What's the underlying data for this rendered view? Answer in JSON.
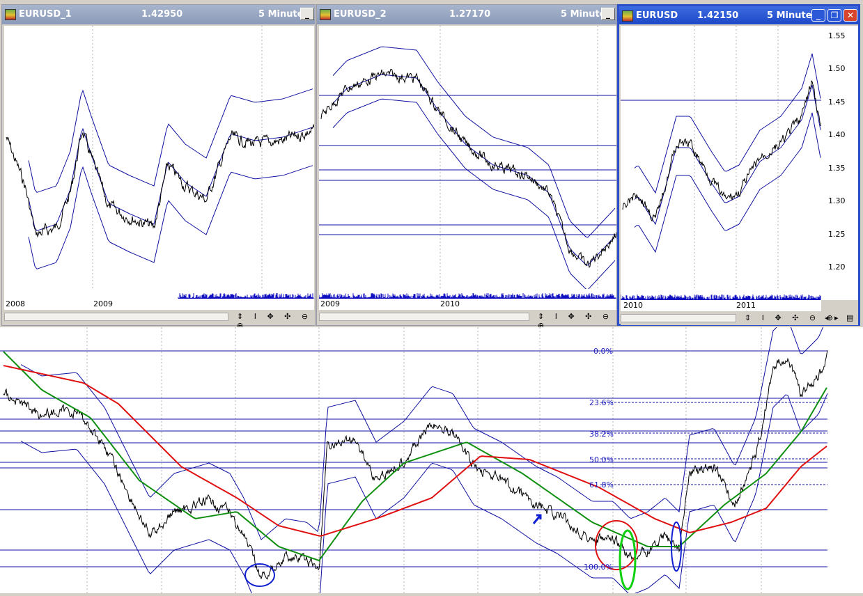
{
  "windows": [
    {
      "name": "EURUSD_1",
      "price": "1.42950",
      "period": "5 Minute",
      "x_labels": [
        "2008",
        "2009"
      ]
    },
    {
      "name": "EURUSD_2",
      "price": "1.27170",
      "period": "5 Minute",
      "x_labels": [
        "2009",
        "2010"
      ]
    },
    {
      "name": "EURUSD",
      "price": "1.42150",
      "period": "5 Minute",
      "x_labels": [
        "2010",
        "2011"
      ],
      "y_labels": [
        "1.55",
        "1.50",
        "1.45",
        "1.40",
        "1.35",
        "1.30",
        "1.25",
        "1.20"
      ]
    }
  ],
  "toolbar_glyphs": "⇕ I ✥ ✣ ⊖ ⊕",
  "window_buttons": {
    "minimize": "_",
    "restore": "❐",
    "close": "✕"
  },
  "scroll_nav": {
    "left": "◂",
    "right": "▸",
    "grid": "▤"
  },
  "main_chart": {
    "fib_levels": [
      "0.0%",
      "23.6%",
      "38.2%",
      "50.0%",
      "61.8%",
      "100.0%"
    ]
  },
  "colors": {
    "price": "#000000",
    "bollinger": "#1010a0",
    "fib_line": "#1010a0",
    "ma_slow": "#e01010",
    "ma_fast": "#109010",
    "annotation_blue": "#1020d0",
    "annotation_red": "#e01010",
    "annotation_green": "#10d010"
  }
}
